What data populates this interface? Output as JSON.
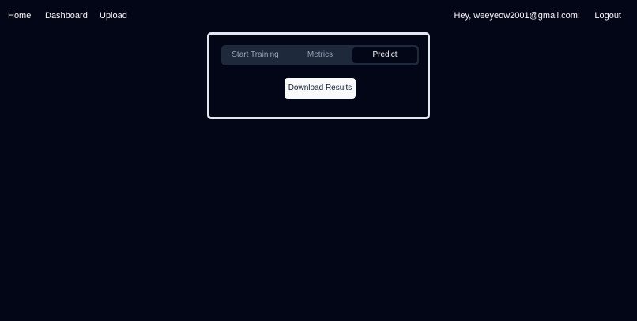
{
  "nav": {
    "home": "Home",
    "dashboard": "Dashboard",
    "upload": "Upload",
    "greeting": "Hey, weeyeow2001@gmail.com!",
    "logout": "Logout"
  },
  "tabs": {
    "items": [
      {
        "label": "Start Training",
        "active": false
      },
      {
        "label": "Metrics",
        "active": false
      },
      {
        "label": "Predict",
        "active": true
      }
    ]
  },
  "predict": {
    "download_label": "Download Results"
  },
  "colors": {
    "background": "#020617",
    "tab_list_bg": "#1e293b",
    "panel_border": "#e2e8f0",
    "button_bg": "#f8fafc",
    "muted_text": "#94a3b8"
  }
}
